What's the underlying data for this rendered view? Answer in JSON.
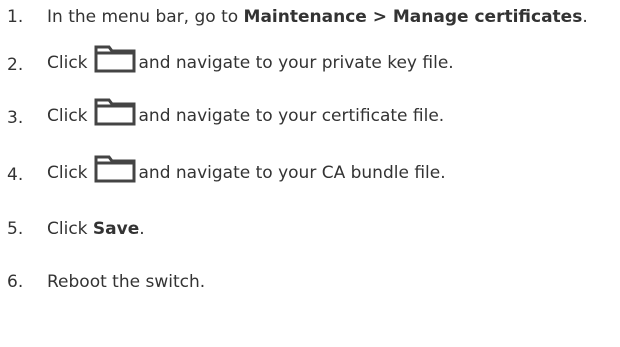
{
  "steps": [
    {
      "number": "1.",
      "text_before": "In the menu bar, go to ",
      "bold": "Maintenance > Manage certificates",
      "text_after": "."
    },
    {
      "number": "2.",
      "text_before": "Click",
      "icon": "folder-icon",
      "text_after": "and navigate to your private key file."
    },
    {
      "number": "3.",
      "text_before": "Click",
      "icon": "folder-icon",
      "text_after": "and navigate to your certificate file."
    },
    {
      "number": "4.",
      "text_before": "Click",
      "icon": "folder-icon",
      "text_after": "and navigate to your CA bundle file."
    },
    {
      "number": "5.",
      "text_before": "Click ",
      "bold": "Save",
      "text_after": "."
    },
    {
      "number": "6.",
      "text": "Reboot the switch."
    }
  ],
  "colors": {
    "text": "#333333",
    "icon_stroke": "#444444",
    "background": "#ffffff"
  }
}
